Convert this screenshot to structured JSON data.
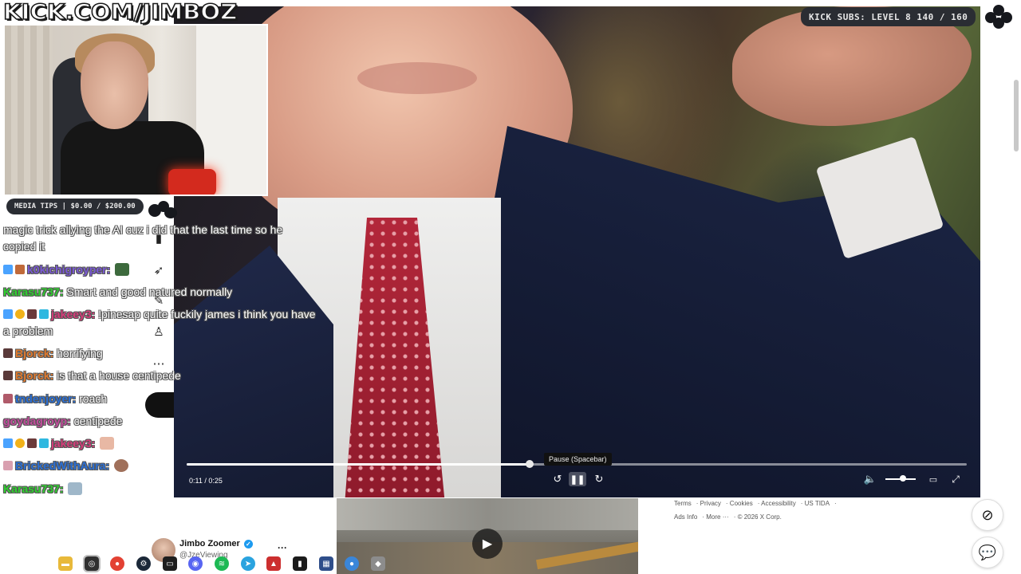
{
  "overlay": {
    "channel_title": "KICK.COM/JIMBOZ",
    "media_tips": "MEDIA TIPS | $0.00 / $200.00",
    "kick_subs": "KICK SUBS: LEVEL 8 140 / 160"
  },
  "player": {
    "current_time": "0:11",
    "duration": "0:25",
    "time_display": "0:11 / 0:25",
    "progress_fraction": 0.44,
    "volume_fraction": 0.6,
    "tooltip": "Pause (Spacebar)",
    "icons": {
      "rewind": "rewind-10-icon",
      "pause": "pause-icon",
      "forward": "forward-10-icon",
      "volume": "volume-icon",
      "captions": "captions-icon",
      "fullscreen": "fullscreen-icon"
    }
  },
  "chat": {
    "messages": [
      {
        "user": "",
        "text": "magic trick allying the AI cuz i did that the last time so he",
        "user_color": "#ffffff"
      },
      {
        "user": "",
        "text": "copied it",
        "user_color": "#ffffff"
      },
      {
        "user": "k0kichigroyper:",
        "text": "",
        "user_color": "#7a59d6"
      },
      {
        "user": "Karasu737:",
        "text": "Smart and good natured normally",
        "user_color": "#2fd02f"
      },
      {
        "user": "jakeey3:",
        "text": "!pinesap quite fuckily james i think you have",
        "user_color": "#d63c7a"
      },
      {
        "user": "",
        "text": "a problem",
        "user_color": "#ffffff"
      },
      {
        "user": "Bjorck:",
        "text": "horrifying",
        "user_color": "#e07a2e"
      },
      {
        "user": "Bjorck:",
        "text": "is that a house centipede",
        "user_color": "#e07a2e"
      },
      {
        "user": "tndenjoyer:",
        "text": "roach",
        "user_color": "#2a6fd6"
      },
      {
        "user": "goydagroyp:",
        "text": "centipede",
        "user_color": "#c44b9d"
      },
      {
        "user": "jakeey3:",
        "text": "",
        "user_color": "#d63c7a"
      },
      {
        "user": "BrickedWithAura:",
        "text": "",
        "user_color": "#2a6fd6"
      },
      {
        "user": "Karasu737:",
        "text": "",
        "user_color": "#2fd02f"
      }
    ]
  },
  "footer": {
    "links_row1": [
      "Terms",
      "Privacy",
      "Cookies",
      "Accessibility",
      "US TIDA"
    ],
    "links_row2": [
      "Ads Info",
      "More ···",
      "© 2026 X Corp."
    ]
  },
  "profile": {
    "name": "Jimbo Zoomer",
    "handle": "@JzeViewing",
    "more": "···"
  },
  "side_buttons": {
    "grok": "grok-icon",
    "messages": "messages-icon"
  },
  "taskbar": [
    "file-explorer-icon",
    "obs-icon",
    "chrome-icon",
    "steam-icon",
    "terminal-icon",
    "discord-icon",
    "spotify-icon",
    "telegram-icon",
    "game-icon",
    "adobe-icon",
    "console-icon",
    "app-icon",
    "chrome-alt-icon",
    "app-alt-icon"
  ]
}
